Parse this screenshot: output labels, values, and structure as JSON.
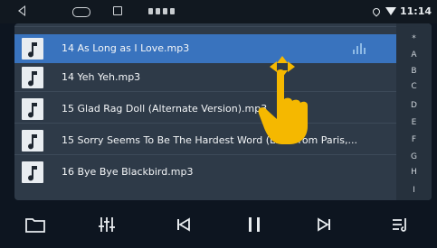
{
  "status": {
    "time": "11:14"
  },
  "songs": [
    {
      "title": ""
    },
    {
      "title": "14 As Long as I Love.mp3"
    },
    {
      "title": "14 Yeh Yeh.mp3"
    },
    {
      "title": "15 Glad Rag Doll (Alternate Version).mp3"
    },
    {
      "title": "15 Sorry Seems To Be The Hardest Word (Live From Paris,..."
    },
    {
      "title": "16 Bye Bye Blackbird.mp3"
    }
  ],
  "index_letters": [
    "*",
    "A",
    "B",
    "C",
    "D",
    "E",
    "F",
    "G",
    "H",
    "I"
  ],
  "colors": {
    "accent": "#3973be",
    "background": "#0d1520",
    "list": "#2e3a48",
    "gesture_hand": "#f5b800"
  },
  "controls": {
    "folder": "folder-icon",
    "eq": "equalizer-icon",
    "prev": "skip-previous-icon",
    "pause": "pause-icon",
    "next": "skip-next-icon",
    "playlist": "playlist-icon"
  }
}
